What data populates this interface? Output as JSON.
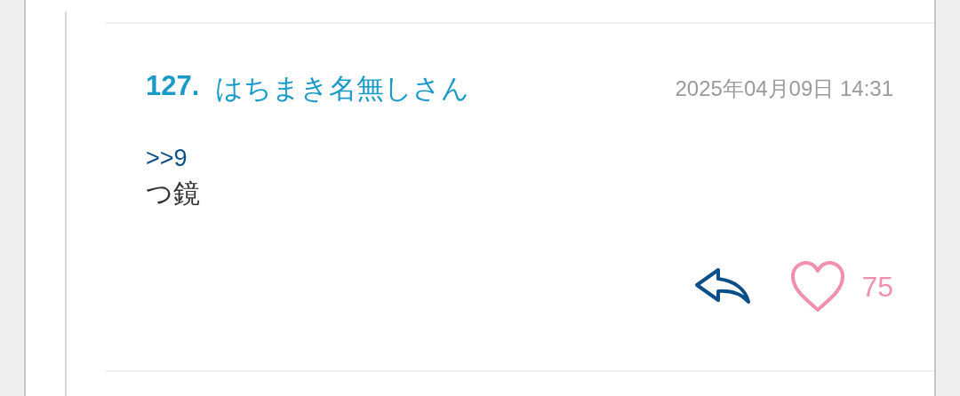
{
  "comment": {
    "number": "127.",
    "author": "はちまき名無しさん",
    "date": "2025年04月09日 14:31",
    "anchor": ">>9",
    "body": "つ鏡",
    "liked": false,
    "like_count": "75"
  }
}
